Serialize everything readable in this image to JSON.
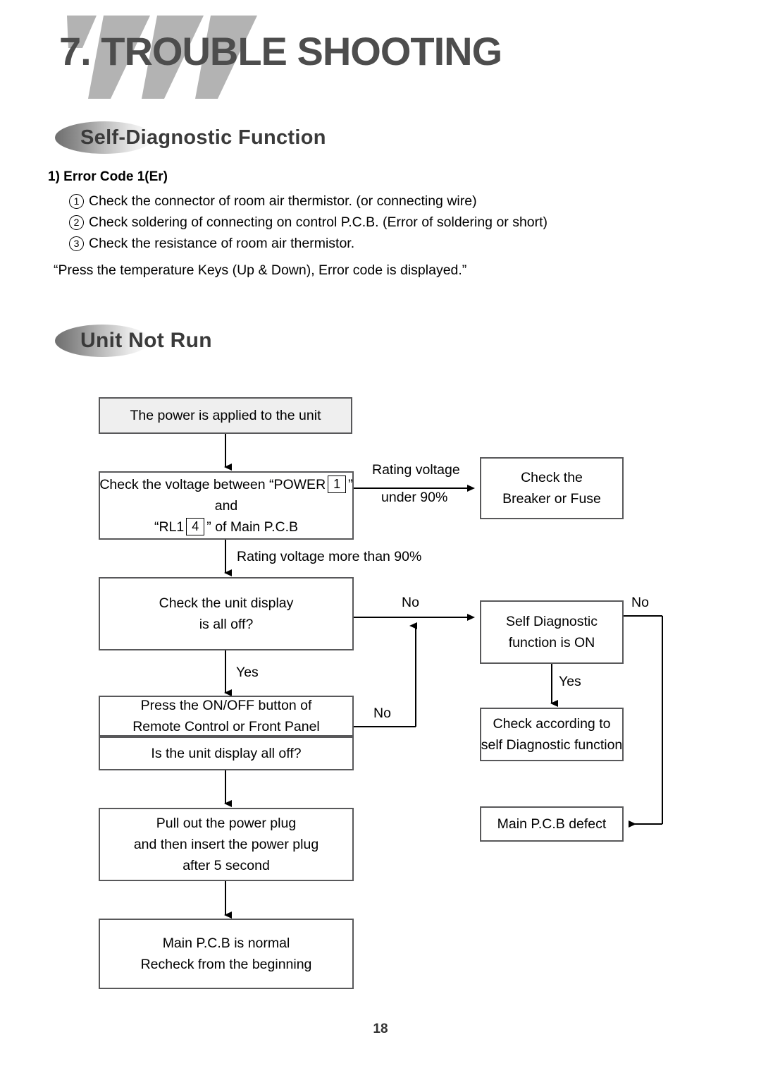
{
  "page": {
    "title": "7. TROUBLE SHOOTING",
    "number": "18"
  },
  "sections": {
    "self_diagnostic": {
      "heading": "Self-Diagnostic Function",
      "error_code_title": "1) Error Code 1(Er)",
      "items": [
        {
          "num": "1",
          "text": "Check the connector of room air thermistor. (or connecting wire)"
        },
        {
          "num": "2",
          "text": "Check soldering of connecting on control P.C.B. (Error of soldering or short)"
        },
        {
          "num": "3",
          "text": "Check the resistance of room air thermistor."
        }
      ],
      "note": "“Press the temperature Keys (Up & Down), Error code is displayed.”"
    },
    "unit_not_run": {
      "heading": "Unit Not Run"
    }
  },
  "flowchart": {
    "nodes": {
      "power_applied": {
        "line1": "The power is applied to the unit"
      },
      "check_voltage": {
        "line1_pre": "Check the voltage between “POWER",
        "line1_box": "1",
        "line1_post": "”",
        "line2": "and",
        "line3_pre": "“RL1",
        "line3_box": "4",
        "line3_post": "” of Main P.C.B"
      },
      "check_breaker": {
        "line1": "Check the",
        "line2": "Breaker or Fuse"
      },
      "check_display": {
        "line1": "Check the unit display",
        "line2": "is all off?"
      },
      "press_onoff": {
        "line1": "Press the ON/OFF button of",
        "line2": "Remote Control or Front Panel",
        "sub": "Is the unit display all off?"
      },
      "pull_plug": {
        "line1": "Pull out the power plug",
        "line2": "and then insert the power plug",
        "line3": "after 5 second"
      },
      "pcb_normal": {
        "line1": "Main P.C.B is normal",
        "line2": "Recheck from the beginning"
      },
      "self_diagnostic_on": {
        "line1": "Self Diagnostic",
        "line2": "function is ON"
      },
      "check_according": {
        "line1": "Check according to",
        "line2": "self Diagnostic function"
      },
      "pcb_defect": {
        "line1": "Main P.C.B defect"
      }
    },
    "edge_labels": {
      "rating_under_1": "Rating voltage",
      "rating_under_2": "under 90%",
      "rating_more": "Rating voltage more than 90%",
      "no_display": "No",
      "yes_display": "Yes",
      "no_onoff": "No",
      "no_selfdiag": "No",
      "yes_selfdiag": "Yes"
    }
  },
  "colors": {
    "title_gray": "#4d4d4d",
    "chevron_gray": "#b3b3b3",
    "box_border": "#58585a",
    "box_shade": "#efefef",
    "line": "#000000"
  }
}
